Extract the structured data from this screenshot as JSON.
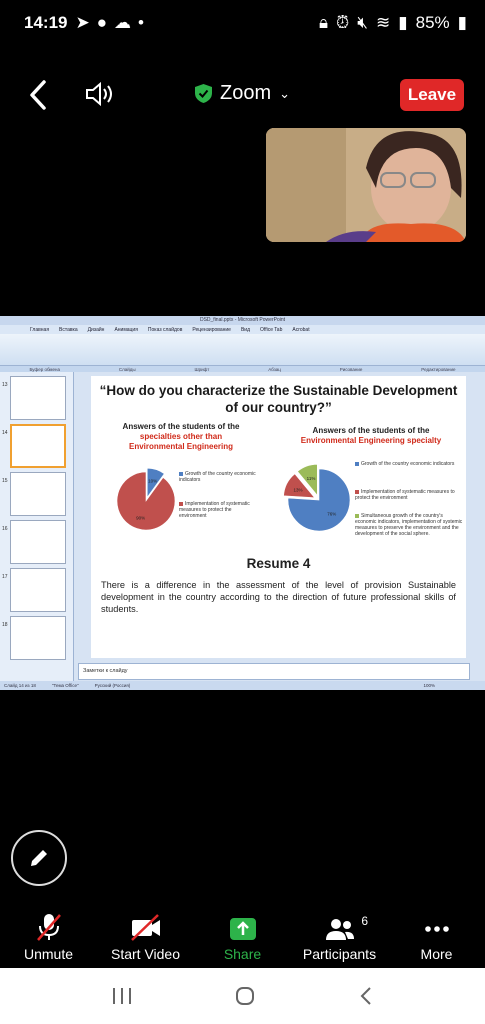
{
  "status_bar": {
    "time": "14:19",
    "battery": "85%"
  },
  "top_bar": {
    "app_name": "Zoom",
    "leave_label": "Leave"
  },
  "ppt": {
    "window_title": "DSD_final.pptx - Microsoft PowerPoint",
    "tabs": [
      "Главная",
      "Вставка",
      "Дизайн",
      "Анимация",
      "Показ слайдов",
      "Рецензирование",
      "Вид",
      "Office Tab",
      "Acrobat"
    ],
    "groups": [
      "Буфер обмена",
      "Слайды",
      "Шрифт",
      "Абзац",
      "Рисование",
      "Редактирование"
    ],
    "thumb_numbers": [
      "13",
      "14",
      "15",
      "16",
      "17",
      "18"
    ],
    "notes_placeholder": "Заметки к слайду",
    "status_left": "Слайд 14 из 18",
    "status_theme": "\"Тема Office\"",
    "status_lang": "Русский (Россия)",
    "zoom": "100%"
  },
  "slide": {
    "title_line1": "“How do you characterize the Sustainable Development",
    "title_line2": "of our country?”",
    "left_heading": "Answers of the students of the",
    "left_heading_red1": "specialties other than",
    "left_heading_red2": "Environmental Engineering",
    "right_heading": "Answers of the students of the",
    "right_heading_red": "Environmental Engineering specialty",
    "left_legend": [
      "Growth of the country economic indicators",
      "Implementation of systematic measures to protect the environment"
    ],
    "right_legend": [
      "Growth of the country economic indicators",
      "Implementation of systematic measures to protect the environment",
      "Simultaneous growth of the country's economic indicators, implementation of systemic measures to preserve the environment and the development of the social sphere."
    ],
    "resume_title": "Resume 4",
    "conclusion": "There is a difference in the assessment of the level of provision Sustainable development in the country according to the direction of future professional skills of students."
  },
  "chart_data": [
    {
      "type": "pie",
      "title": "",
      "labels": [
        "Growth of the country economic indicators",
        "Implementation of systematic measures to protect the environment"
      ],
      "values": [
        10,
        90
      ],
      "colors": [
        "#4f7fc2",
        "#c0504d"
      ]
    },
    {
      "type": "pie",
      "title": "",
      "labels": [
        "Growth of the country economic indicators",
        "Implementation of systematic measures to protect the environment",
        "Simultaneous growth of the country's economic indicators, implementation of systemic measures to preserve the environment and the development of the social sphere."
      ],
      "values": [
        76,
        13,
        11
      ],
      "colors": [
        "#4f7fc2",
        "#c0504d",
        "#9bbb59"
      ]
    }
  ],
  "toolbar": {
    "unmute": "Unmute",
    "start_video": "Start Video",
    "share": "Share",
    "participants": "Participants",
    "participants_count": "6",
    "more": "More"
  }
}
